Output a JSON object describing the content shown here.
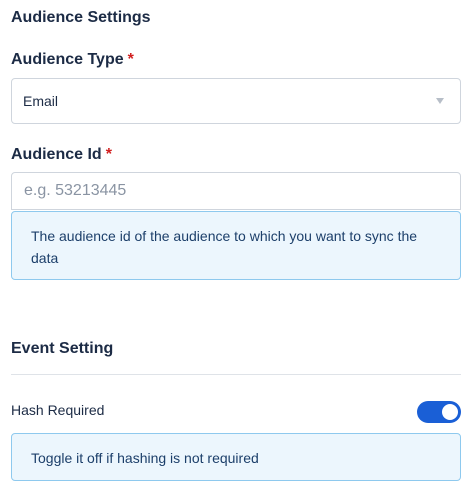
{
  "audience_settings": {
    "title": "Audience Settings",
    "audience_type": {
      "label": "Audience Type",
      "required_mark": "*",
      "selected_value": "Email"
    },
    "audience_id": {
      "label": "Audience Id",
      "required_mark": "*",
      "value": "",
      "placeholder": "e.g. 53213445",
      "help_text": "The audience id of the audience to which you want to sync the data"
    }
  },
  "event_setting": {
    "title": "Event Setting",
    "hash_required": {
      "label": "Hash Required",
      "enabled": true,
      "help_text": "Toggle it off if hashing is not required"
    }
  },
  "colors": {
    "accent": "#1a5fd6",
    "required": "#d11f1f",
    "info_background": "#ecf6fd",
    "info_border": "#8ec9ee"
  }
}
